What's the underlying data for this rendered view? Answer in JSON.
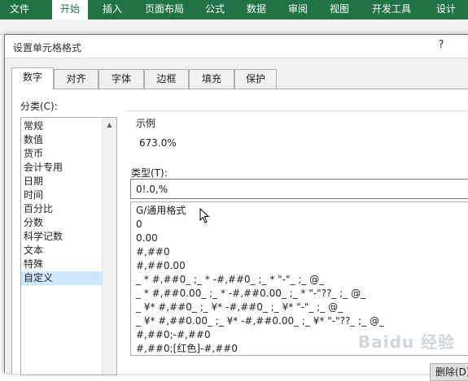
{
  "ribbon": {
    "tabs": [
      {
        "label": "文件"
      },
      {
        "label": "开始"
      },
      {
        "label": "插入"
      },
      {
        "label": "页面布局"
      },
      {
        "label": "公式"
      },
      {
        "label": "数据"
      },
      {
        "label": "审阅"
      },
      {
        "label": "视图"
      },
      {
        "label": "开发工具"
      },
      {
        "label": "设计"
      }
    ],
    "active_tab": "开始",
    "color": "#217346"
  },
  "dialog": {
    "title": "设置单元格格式",
    "help": "?",
    "tabs": [
      "数字",
      "对齐",
      "字体",
      "边框",
      "填充",
      "保护"
    ],
    "active_tab": "数字",
    "category_label": "分类(C):",
    "categories": [
      "常规",
      "数值",
      "货币",
      "会计专用",
      "日期",
      "时间",
      "百分比",
      "分数",
      "科学记数",
      "文本",
      "特殊",
      "自定义"
    ],
    "selected_category": "自定义",
    "sample_label": "示例",
    "sample_value": "673.0%",
    "type_label": "类型(T):",
    "type_value": "0!.0,%",
    "formats": [
      "G/通用格式",
      "0",
      "0.00",
      "#,##0",
      "#,##0.00",
      "_ * #,##0_ ;_ * -#,##0_ ;_ * \"-\"_ ;_ @_",
      "_ * #,##0.00_ ;_ * -#,##0.00_ ;_ * \"-\"??_ ;_ @_",
      "_ ¥* #,##0_ ;_ ¥* -#,##0_ ;_ ¥* \"-\"_ ;_ @_",
      "_ ¥* #,##0.00_ ;_ ¥* -#,##0.00_ ;_ ¥* \"-\"??_ ;_ @_",
      "#,##0;-#,##0",
      "#,##0;[红色]-#,##0"
    ],
    "delete_label": "删除(D)"
  },
  "watermark": "Baidu 经验",
  "icons": {
    "cursor": "mouse-pointer-icon",
    "scroll_up": "scroll-up-arrow-icon",
    "scroll_down": "scroll-down-arrow-icon"
  },
  "colors": {
    "selection": "#cce8ff",
    "dialog_bg": "#f0f0f0"
  }
}
